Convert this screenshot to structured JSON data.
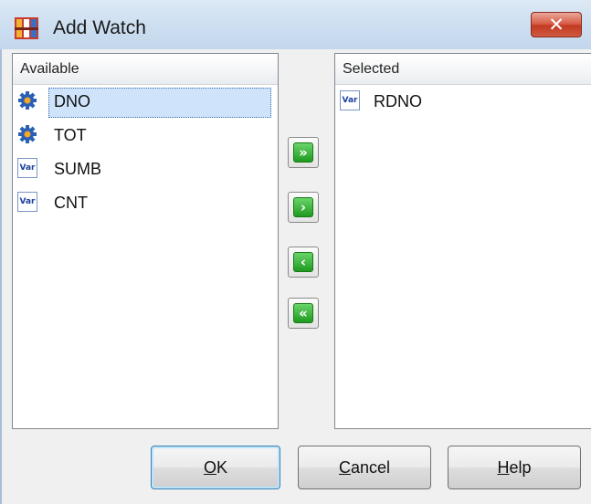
{
  "window": {
    "title": "Add Watch",
    "close_glyph": "✕"
  },
  "available": {
    "header": "Available",
    "items": [
      {
        "label": "DNO",
        "icon": "gear-icon",
        "selected": true
      },
      {
        "label": "TOT",
        "icon": "gear-icon",
        "selected": false
      },
      {
        "label": "SUMB",
        "icon": "var-icon",
        "selected": false
      },
      {
        "label": "CNT",
        "icon": "var-icon",
        "selected": false
      }
    ]
  },
  "selected": {
    "header": "Selected",
    "items": [
      {
        "label": "RDNO",
        "icon": "var-icon"
      }
    ]
  },
  "icon_text": {
    "var": "Var"
  },
  "arrows": {
    "add_all": "»",
    "add": "›",
    "remove": "‹",
    "remove_all": "«"
  },
  "buttons": {
    "ok": {
      "mnemonic": "O",
      "rest": "K"
    },
    "cancel": {
      "mnemonic": "C",
      "rest": "ancel"
    },
    "help": {
      "mnemonic": "H",
      "rest": "elp"
    }
  },
  "colors": {
    "accent_green": "#1f9a1f",
    "selection": "#cfe4fb",
    "title_bar": "#cfe0f1"
  }
}
